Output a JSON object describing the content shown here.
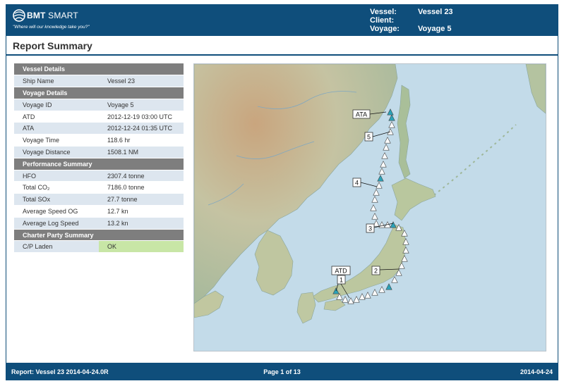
{
  "header": {
    "brand_bold": "BMT",
    "brand_light": "SMART",
    "tagline": "\"Where will our knowledge take you?\"",
    "vessel_label": "Vessel:",
    "vessel_value": "Vessel 23",
    "client_label": "Client:",
    "client_value": "",
    "voyage_label": "Voyage:",
    "voyage_value": "Voyage 5"
  },
  "page_title": "Report Summary",
  "sections": {
    "vessel_details": "Vessel Details",
    "voyage_details": "Voyage Details",
    "performance_summary": "Performance Summary",
    "charter_party_summary": "Charter Party Summary"
  },
  "vessel_details": [
    {
      "label": "Ship Name",
      "value": "Vessel 23"
    }
  ],
  "voyage_details": [
    {
      "label": "Voyage ID",
      "value": "Voyage 5"
    },
    {
      "label": "ATD",
      "value": "2012-12-19 03:00 UTC"
    },
    {
      "label": "ATA",
      "value": "2012-12-24 01:35 UTC"
    },
    {
      "label": "Voyage Time",
      "value": "118.6 hr"
    },
    {
      "label": "Voyage Distance",
      "value": "1508.1 NM"
    }
  ],
  "performance_summary": [
    {
      "label": "HFO",
      "value": "2307.4 tonne"
    },
    {
      "label": "Total CO₂",
      "value": "7186.0 tonne"
    },
    {
      "label": "Total SOx",
      "value": "27.7 tonne"
    },
    {
      "label": "Average Speed OG",
      "value": "12.7 kn"
    },
    {
      "label": "Average Log Speed",
      "value": "13.2 kn"
    }
  ],
  "charter_party_summary": [
    {
      "label": "C/P Laden",
      "value": "OK",
      "status_color": "#c8e6a6"
    }
  ],
  "map": {
    "labels": {
      "atd": "ATD",
      "ata": "ATA",
      "m1": "1",
      "m2": "2",
      "m3": "3",
      "m4": "4",
      "m5": "5"
    }
  },
  "footer": {
    "report": "Report: Vessel 23 2014-04-24.0R",
    "page": "Page 1 of 13",
    "date": "2014-04-24"
  },
  "colors": {
    "brand_blue": "#0f4e7b",
    "section_gray": "#7e7e7e",
    "row_alt": "#dde6ef",
    "ok_green": "#c8e6a6",
    "sea": "#c3dbe9",
    "land": "#c9c7a8",
    "route_marker": "#2aa2b8"
  }
}
